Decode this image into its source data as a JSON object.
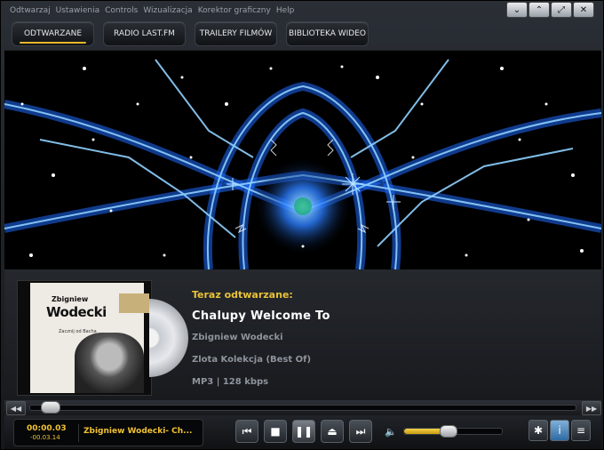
{
  "menu": [
    "Odtwarzaj",
    "Ustawienia",
    "Controls",
    "Wizualizacja",
    "Korektor graficzny",
    "Help"
  ],
  "window_controls": {
    "down": "⌄",
    "up": "⌃",
    "restore": "⤢",
    "close": "✕"
  },
  "tabs": [
    {
      "label": "ODTWARZANE",
      "active": true
    },
    {
      "label": "RADIO LAST.FM",
      "active": false
    },
    {
      "label": "TRAILERY FILMÓW",
      "active": false
    },
    {
      "label": "BIBLIOTEKA WIDEO",
      "active": false
    }
  ],
  "album": {
    "cover_name_small": "Zbigniew",
    "cover_name_big": "Wodecki",
    "cover_subtitle": "Zacznij od Bacha"
  },
  "now_playing": {
    "label": "Teraz odtwarzane:",
    "title": "Chalupy Welcome To",
    "artist": "Zbigniew Wodecki",
    "album": "Zlota Kolekcja (Best Of)",
    "format": "MP3 | 128 kbps"
  },
  "seek": {
    "back_label": "◀◀",
    "fwd_label": "▶▶",
    "position": 0.02
  },
  "display": {
    "elapsed": "00:00.03",
    "remaining": "-00.03.14",
    "track": "Zbigniew Wodecki- Ch..."
  },
  "transport": {
    "prev": "⏮",
    "stop": "■",
    "pause": "❚❚",
    "eject": "⏏",
    "next": "⏭"
  },
  "volume": {
    "icon": "🔈",
    "level": 0.45
  },
  "settings_buttons": {
    "gear": "✱",
    "info": "i",
    "menu": "≡"
  },
  "colors": {
    "accent": "#e8c23a",
    "viz_blue": "#2f8cff"
  }
}
